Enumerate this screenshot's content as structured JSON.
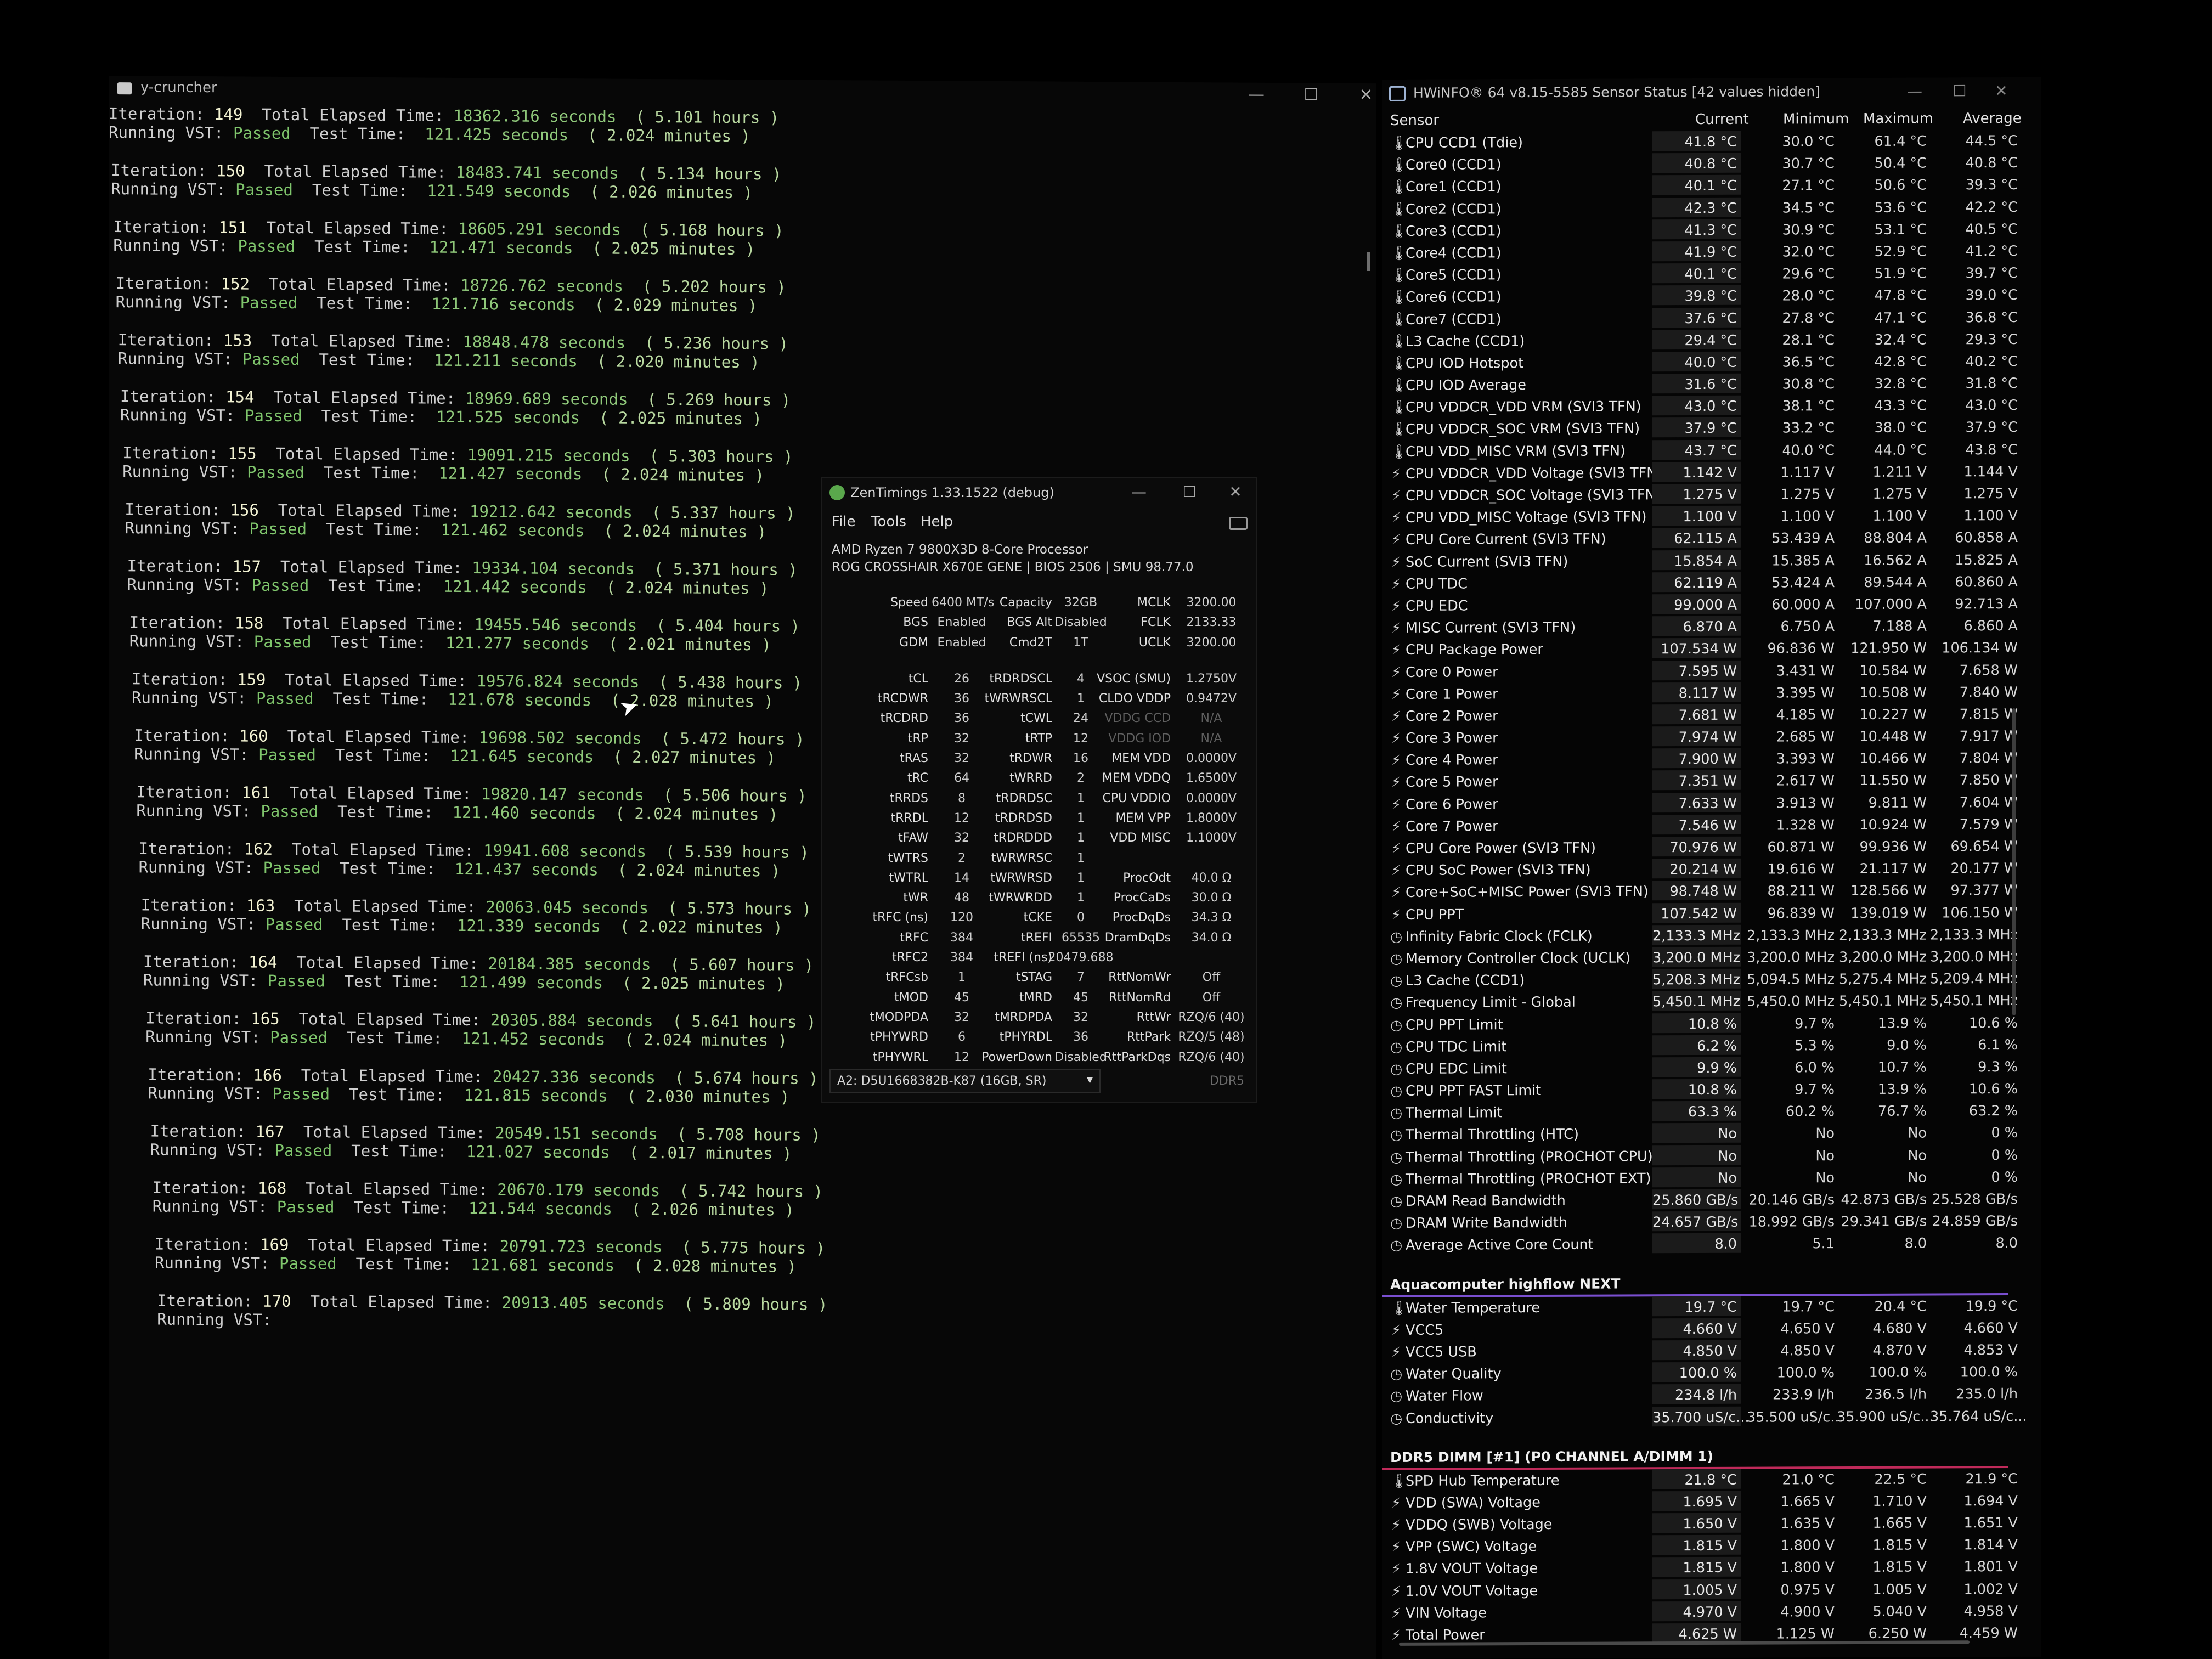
{
  "ycruncher": {
    "title": "y-cruncher",
    "iterations": [
      {
        "n": "149",
        "elapsed": "18362.316 seconds",
        "hours": "( 5.101 hours )",
        "status": "Passed",
        "test_time": "121.425 seconds",
        "minutes": "( 2.024 minutes )"
      },
      {
        "n": "150",
        "elapsed": "18483.741 seconds",
        "hours": "( 5.134 hours )",
        "status": "Passed",
        "test_time": "121.549 seconds",
        "minutes": "( 2.026 minutes )"
      },
      {
        "n": "151",
        "elapsed": "18605.291 seconds",
        "hours": "( 5.168 hours )",
        "status": "Passed",
        "test_time": "121.471 seconds",
        "minutes": "( 2.025 minutes )"
      },
      {
        "n": "152",
        "elapsed": "18726.762 seconds",
        "hours": "( 5.202 hours )",
        "status": "Passed",
        "test_time": "121.716 seconds",
        "minutes": "( 2.029 minutes )"
      },
      {
        "n": "153",
        "elapsed": "18848.478 seconds",
        "hours": "( 5.236 hours )",
        "status": "Passed",
        "test_time": "121.211 seconds",
        "minutes": "( 2.020 minutes )"
      },
      {
        "n": "154",
        "elapsed": "18969.689 seconds",
        "hours": "( 5.269 hours )",
        "status": "Passed",
        "test_time": "121.525 seconds",
        "minutes": "( 2.025 minutes )"
      },
      {
        "n": "155",
        "elapsed": "19091.215 seconds",
        "hours": "( 5.303 hours )",
        "status": "Passed",
        "test_time": "121.427 seconds",
        "minutes": "( 2.024 minutes )"
      },
      {
        "n": "156",
        "elapsed": "19212.642 seconds",
        "hours": "( 5.337 hours )",
        "status": "Passed",
        "test_time": "121.462 seconds",
        "minutes": "( 2.024 minutes )"
      },
      {
        "n": "157",
        "elapsed": "19334.104 seconds",
        "hours": "( 5.371 hours )",
        "status": "Passed",
        "test_time": "121.442 seconds",
        "minutes": "( 2.024 minutes )"
      },
      {
        "n": "158",
        "elapsed": "19455.546 seconds",
        "hours": "( 5.404 hours )",
        "status": "Passed",
        "test_time": "121.277 seconds",
        "minutes": "( 2.021 minutes )"
      },
      {
        "n": "159",
        "elapsed": "19576.824 seconds",
        "hours": "( 5.438 hours )",
        "status": "Passed",
        "test_time": "121.678 seconds",
        "minutes": "( 2.028 minutes )"
      },
      {
        "n": "160",
        "elapsed": "19698.502 seconds",
        "hours": "( 5.472 hours )",
        "status": "Passed",
        "test_time": "121.645 seconds",
        "minutes": "( 2.027 minutes )"
      },
      {
        "n": "161",
        "elapsed": "19820.147 seconds",
        "hours": "( 5.506 hours )",
        "status": "Passed",
        "test_time": "121.460 seconds",
        "minutes": "( 2.024 minutes )"
      },
      {
        "n": "162",
        "elapsed": "19941.608 seconds",
        "hours": "( 5.539 hours )",
        "status": "Passed",
        "test_time": "121.437 seconds",
        "minutes": "( 2.024 minutes )"
      },
      {
        "n": "163",
        "elapsed": "20063.045 seconds",
        "hours": "( 5.573 hours )",
        "status": "Passed",
        "test_time": "121.339 seconds",
        "minutes": "( 2.022 minutes )"
      },
      {
        "n": "164",
        "elapsed": "20184.385 seconds",
        "hours": "( 5.607 hours )",
        "status": "Passed",
        "test_time": "121.499 seconds",
        "minutes": "( 2.025 minutes )"
      },
      {
        "n": "165",
        "elapsed": "20305.884 seconds",
        "hours": "( 5.641 hours )",
        "status": "Passed",
        "test_time": "121.452 seconds",
        "minutes": "( 2.024 minutes )"
      },
      {
        "n": "166",
        "elapsed": "20427.336 seconds",
        "hours": "( 5.674 hours )",
        "status": "Passed",
        "test_time": "121.815 seconds",
        "minutes": "( 2.030 minutes )"
      },
      {
        "n": "167",
        "elapsed": "20549.151 seconds",
        "hours": "( 5.708 hours )",
        "status": "Passed",
        "test_time": "121.027 seconds",
        "minutes": "( 2.017 minutes )"
      },
      {
        "n": "168",
        "elapsed": "20670.179 seconds",
        "hours": "( 5.742 hours )",
        "status": "Passed",
        "test_time": "121.544 seconds",
        "minutes": "( 2.026 minutes )"
      },
      {
        "n": "169",
        "elapsed": "20791.723 seconds",
        "hours": "( 5.775 hours )",
        "status": "Passed",
        "test_time": "121.681 seconds",
        "minutes": "( 2.028 minutes )"
      },
      {
        "n": "170",
        "elapsed": "20913.405 seconds",
        "hours": "( 5.809 hours )",
        "status": "",
        "test_time": "",
        "minutes": ""
      }
    ],
    "labels": {
      "iteration": "Iteration:",
      "total": "Total Elapsed Time:",
      "running": "Running VST:",
      "test": "Test Time:"
    }
  },
  "zentimings": {
    "title": "ZenTimings 1.33.1522 (debug)",
    "menu": [
      "File",
      "Tools",
      "Help"
    ],
    "cpu": "AMD Ryzen 7 9800X3D 8-Core Processor",
    "board": "ROG CROSSHAIR X670E GENE | BIOS 2506 | SMU 98.77.0",
    "rows": [
      [
        "Speed",
        "6400 MT/s",
        "Capacity",
        "32GB",
        "MCLK",
        "3200.00"
      ],
      [
        "BGS",
        "Enabled",
        "BGS Alt",
        "Disabled",
        "FCLK",
        "2133.33"
      ],
      [
        "GDM",
        "Enabled",
        "Cmd2T",
        "1T",
        "UCLK",
        "3200.00"
      ],
      [
        "tCL",
        "26",
        "tRDRDSCL",
        "4",
        "VSOC (SMU)",
        "1.2750V"
      ],
      [
        "tRCDWR",
        "36",
        "tWRWRSCL",
        "1",
        "CLDO VDDP",
        "0.9472V"
      ],
      [
        "tRCDRD",
        "36",
        "tCWL",
        "24",
        "VDDG CCD",
        "N/A"
      ],
      [
        "tRP",
        "32",
        "tRTP",
        "12",
        "VDDG IOD",
        "N/A"
      ],
      [
        "tRAS",
        "32",
        "tRDWR",
        "16",
        "MEM VDD",
        "0.0000V"
      ],
      [
        "tRC",
        "64",
        "tWRRD",
        "2",
        "MEM VDDQ",
        "1.6500V"
      ],
      [
        "tRRDS",
        "8",
        "tRDRDSC",
        "1",
        "CPU VDDIO",
        "0.0000V"
      ],
      [
        "tRRDL",
        "12",
        "tRDRDSD",
        "1",
        "MEM VPP",
        "1.8000V"
      ],
      [
        "tFAW",
        "32",
        "tRDRDDD",
        "1",
        "VDD MISC",
        "1.1000V"
      ],
      [
        "tWTRS",
        "2",
        "tWRWRSC",
        "1",
        "",
        ""
      ],
      [
        "tWTRL",
        "14",
        "tWRWRSD",
        "1",
        "ProcOdt",
        "40.0 Ω"
      ],
      [
        "tWR",
        "48",
        "tWRWRDD",
        "1",
        "ProcCaDs",
        "30.0 Ω"
      ],
      [
        "tRFC (ns)",
        "120",
        "tCKE",
        "0",
        "ProcDqDs",
        "34.3 Ω"
      ],
      [
        "tRFC",
        "384",
        "tREFI",
        "65535",
        "DramDqDs",
        "34.0 Ω"
      ],
      [
        "tRFC2",
        "384",
        "tREFI (ns)",
        "20479.688",
        "",
        ""
      ],
      [
        "tRFCsb",
        "1",
        "tSTAG",
        "7",
        "RttNomWr",
        "Off"
      ],
      [
        "tMOD",
        "45",
        "tMRD",
        "45",
        "RttNomRd",
        "Off"
      ],
      [
        "tMODPDA",
        "32",
        "tMRDPDA",
        "32",
        "RttWr",
        "RZQ/6 (40)"
      ],
      [
        "tPHYWRD",
        "6",
        "tPHYRDL",
        "36",
        "RttPark",
        "RZQ/5 (48)"
      ],
      [
        "tPHYWRL",
        "12",
        "PowerDown",
        "Disabled",
        "RttParkDqs",
        "RZQ/6 (40)"
      ]
    ],
    "dimm": "A2: D5U1668382B-K87 (16GB, SR)",
    "mem_type": "DDR5"
  },
  "hwinfo": {
    "title": "HWiNFO® 64 v8.15-5585 Sensor Status [42 values hidden]",
    "columns": [
      "Sensor",
      "Current",
      "Minimum",
      "Maximum",
      "Average"
    ],
    "cpu_rows": [
      [
        "therm",
        "CPU CCD1 (Tdie)",
        "41.8 °C",
        "30.0 °C",
        "61.4 °C",
        "44.5 °C"
      ],
      [
        "therm",
        "Core0 (CCD1)",
        "40.8 °C",
        "30.7 °C",
        "50.4 °C",
        "40.8 °C"
      ],
      [
        "therm",
        "Core1 (CCD1)",
        "40.1 °C",
        "27.1 °C",
        "50.6 °C",
        "39.3 °C"
      ],
      [
        "therm",
        "Core2 (CCD1)",
        "42.3 °C",
        "34.5 °C",
        "53.6 °C",
        "42.2 °C"
      ],
      [
        "therm",
        "Core3 (CCD1)",
        "41.3 °C",
        "30.9 °C",
        "53.1 °C",
        "40.5 °C"
      ],
      [
        "therm",
        "Core4 (CCD1)",
        "41.9 °C",
        "32.0 °C",
        "52.9 °C",
        "41.2 °C"
      ],
      [
        "therm",
        "Core5 (CCD1)",
        "40.1 °C",
        "29.6 °C",
        "51.9 °C",
        "39.7 °C"
      ],
      [
        "therm",
        "Core6 (CCD1)",
        "39.8 °C",
        "28.0 °C",
        "47.8 °C",
        "39.0 °C"
      ],
      [
        "therm",
        "Core7 (CCD1)",
        "37.6 °C",
        "27.8 °C",
        "47.1 °C",
        "36.8 °C"
      ],
      [
        "therm",
        "L3 Cache (CCD1)",
        "29.4 °C",
        "28.1 °C",
        "32.4 °C",
        "29.3 °C"
      ],
      [
        "therm",
        "CPU IOD Hotspot",
        "40.0 °C",
        "36.5 °C",
        "42.8 °C",
        "40.2 °C"
      ],
      [
        "therm",
        "CPU IOD Average",
        "31.6 °C",
        "30.8 °C",
        "32.8 °C",
        "31.8 °C"
      ],
      [
        "therm",
        "CPU VDDCR_VDD VRM (SVI3 TFN)",
        "43.0 °C",
        "38.1 °C",
        "43.3 °C",
        "43.0 °C"
      ],
      [
        "therm",
        "CPU VDDCR_SOC VRM (SVI3 TFN)",
        "37.9 °C",
        "33.2 °C",
        "38.0 °C",
        "37.9 °C"
      ],
      [
        "therm",
        "CPU VDD_MISC VRM (SVI3 TFN)",
        "43.7 °C",
        "40.0 °C",
        "44.0 °C",
        "43.8 °C"
      ],
      [
        "bolt",
        "CPU VDDCR_VDD Voltage (SVI3 TFN)",
        "1.142 V",
        "1.117 V",
        "1.211 V",
        "1.144 V"
      ],
      [
        "bolt",
        "CPU VDDCR_SOC Voltage (SVI3 TFN)",
        "1.275 V",
        "1.275 V",
        "1.275 V",
        "1.275 V"
      ],
      [
        "bolt",
        "CPU VDD_MISC Voltage (SVI3 TFN)",
        "1.100 V",
        "1.100 V",
        "1.100 V",
        "1.100 V"
      ],
      [
        "bolt",
        "CPU Core Current (SVI3 TFN)",
        "62.115 A",
        "53.439 A",
        "88.804 A",
        "60.858 A"
      ],
      [
        "bolt",
        "SoC Current (SVI3 TFN)",
        "15.854 A",
        "15.385 A",
        "16.562 A",
        "15.825 A"
      ],
      [
        "bolt",
        "CPU TDC",
        "62.119 A",
        "53.424 A",
        "89.544 A",
        "60.860 A"
      ],
      [
        "bolt",
        "CPU EDC",
        "99.000 A",
        "60.000 A",
        "107.000 A",
        "92.713 A"
      ],
      [
        "bolt",
        "MISC Current (SVI3 TFN)",
        "6.870 A",
        "6.750 A",
        "7.188 A",
        "6.860 A"
      ],
      [
        "bolt",
        "CPU Package Power",
        "107.534 W",
        "96.836 W",
        "121.950 W",
        "106.134 W"
      ],
      [
        "bolt",
        "Core 0 Power",
        "7.595 W",
        "3.431 W",
        "10.584 W",
        "7.658 W"
      ],
      [
        "bolt",
        "Core 1 Power",
        "8.117 W",
        "3.395 W",
        "10.508 W",
        "7.840 W"
      ],
      [
        "bolt",
        "Core 2 Power",
        "7.681 W",
        "4.185 W",
        "10.227 W",
        "7.815 W"
      ],
      [
        "bolt",
        "Core 3 Power",
        "7.974 W",
        "2.685 W",
        "10.448 W",
        "7.917 W"
      ],
      [
        "bolt",
        "Core 4 Power",
        "7.900 W",
        "3.393 W",
        "10.466 W",
        "7.804 W"
      ],
      [
        "bolt",
        "Core 5 Power",
        "7.351 W",
        "2.617 W",
        "11.550 W",
        "7.850 W"
      ],
      [
        "bolt",
        "Core 6 Power",
        "7.633 W",
        "3.913 W",
        "9.811 W",
        "7.604 W"
      ],
      [
        "bolt",
        "Core 7 Power",
        "7.546 W",
        "1.328 W",
        "10.924 W",
        "7.579 W"
      ],
      [
        "bolt",
        "CPU Core Power (SVI3 TFN)",
        "70.976 W",
        "60.871 W",
        "99.936 W",
        "69.654 W"
      ],
      [
        "bolt",
        "CPU SoC Power (SVI3 TFN)",
        "20.214 W",
        "19.616 W",
        "21.117 W",
        "20.177 W"
      ],
      [
        "bolt",
        "Core+SoC+MISC Power (SVI3 TFN)",
        "98.748 W",
        "88.211 W",
        "128.566 W",
        "97.377 W"
      ],
      [
        "bolt",
        "CPU PPT",
        "107.542 W",
        "96.839 W",
        "139.019 W",
        "106.150 W"
      ],
      [
        "clock",
        "Infinity Fabric Clock (FCLK)",
        "2,133.3 MHz",
        "2,133.3 MHz",
        "2,133.3 MHz",
        "2,133.3 MHz"
      ],
      [
        "clock",
        "Memory Controller Clock (UCLK)",
        "3,200.0 MHz",
        "3,200.0 MHz",
        "3,200.0 MHz",
        "3,200.0 MHz"
      ],
      [
        "clock",
        "L3 Cache (CCD1)",
        "5,208.3 MHz",
        "5,094.5 MHz",
        "5,275.4 MHz",
        "5,209.4 MHz"
      ],
      [
        "clock",
        "Frequency Limit - Global",
        "5,450.1 MHz",
        "5,450.0 MHz",
        "5,450.1 MHz",
        "5,450.1 MHz"
      ],
      [
        "clock",
        "CPU PPT Limit",
        "10.8 %",
        "9.7 %",
        "13.9 %",
        "10.6 %"
      ],
      [
        "clock",
        "CPU TDC Limit",
        "6.2 %",
        "5.3 %",
        "9.0 %",
        "6.1 %"
      ],
      [
        "clock",
        "CPU EDC Limit",
        "9.9 %",
        "6.0 %",
        "10.7 %",
        "9.3 %"
      ],
      [
        "clock",
        "CPU PPT FAST Limit",
        "10.8 %",
        "9.7 %",
        "13.9 %",
        "10.6 %"
      ],
      [
        "clock",
        "Thermal Limit",
        "63.3 %",
        "60.2 %",
        "76.7 %",
        "63.2 %"
      ],
      [
        "clock",
        "Thermal Throttling (HTC)",
        "No",
        "No",
        "No",
        "0 %"
      ],
      [
        "clock",
        "Thermal Throttling (PROCHOT CPU)",
        "No",
        "No",
        "No",
        "0 %"
      ],
      [
        "clock",
        "Thermal Throttling (PROCHOT EXT)",
        "No",
        "No",
        "No",
        "0 %"
      ],
      [
        "clock",
        "DRAM Read Bandwidth",
        "25.860 GB/s",
        "20.146 GB/s",
        "42.873 GB/s",
        "25.528 GB/s"
      ],
      [
        "clock",
        "DRAM Write Bandwidth",
        "24.657 GB/s",
        "18.992 GB/s",
        "29.341 GB/s",
        "24.859 GB/s"
      ],
      [
        "clock",
        "Average Active Core Count",
        "8.0",
        "5.1",
        "8.0",
        "8.0"
      ]
    ],
    "aqua_title": "Aquacomputer highflow NEXT",
    "aqua_color": "#7a4fd0",
    "aqua_rows": [
      [
        "therm",
        "Water Temperature",
        "19.7 °C",
        "19.7 °C",
        "20.4 °C",
        "19.9 °C"
      ],
      [
        "bolt",
        "VCC5",
        "4.660 V",
        "4.650 V",
        "4.680 V",
        "4.660 V"
      ],
      [
        "bolt",
        "VCC5 USB",
        "4.850 V",
        "4.850 V",
        "4.870 V",
        "4.853 V"
      ],
      [
        "clock",
        "Water Quality",
        "100.0 %",
        "100.0 %",
        "100.0 %",
        "100.0 %"
      ],
      [
        "clock",
        "Water Flow",
        "234.8 l/h",
        "233.9 l/h",
        "236.5 l/h",
        "235.0 l/h"
      ],
      [
        "clock",
        "Conductivity",
        "35.700 uS/c...",
        "35.500 uS/c...",
        "35.900 uS/c...",
        "35.764 uS/c..."
      ]
    ],
    "dimm_title": "DDR5 DIMM [#1] (P0 CHANNEL A/DIMM 1)",
    "dimm_color": "#c02a5a",
    "dimm_rows": [
      [
        "therm",
        "SPD Hub Temperature",
        "21.8 °C",
        "21.0 °C",
        "22.5 °C",
        "21.9 °C"
      ],
      [
        "bolt",
        "VDD (SWA) Voltage",
        "1.695 V",
        "1.665 V",
        "1.710 V",
        "1.694 V"
      ],
      [
        "bolt",
        "VDDQ (SWB) Voltage",
        "1.650 V",
        "1.635 V",
        "1.665 V",
        "1.651 V"
      ],
      [
        "bolt",
        "VPP (SWC) Voltage",
        "1.815 V",
        "1.800 V",
        "1.815 V",
        "1.814 V"
      ],
      [
        "bolt",
        "1.8V VOUT Voltage",
        "1.815 V",
        "1.800 V",
        "1.815 V",
        "1.801 V"
      ],
      [
        "bolt",
        "1.0V VOUT Voltage",
        "1.005 V",
        "0.975 V",
        "1.005 V",
        "1.002 V"
      ],
      [
        "bolt",
        "VIN Voltage",
        "4.970 V",
        "4.900 V",
        "5.040 V",
        "4.958 V"
      ],
      [
        "bolt",
        "Total Power",
        "4.625 W",
        "1.125 W",
        "6.250 W",
        "4.459 W"
      ]
    ]
  },
  "window_controls": {
    "min": "—",
    "max": "☐",
    "close": "✕"
  },
  "icons": {
    "therm": "thermometer-icon",
    "bolt": "bolt-icon",
    "clock": "clock-icon"
  },
  "glyphs": {
    "therm": "🌡",
    "bolt": "⚡",
    "clock": "◷",
    "chevron": "▾",
    "section": "⚙"
  }
}
